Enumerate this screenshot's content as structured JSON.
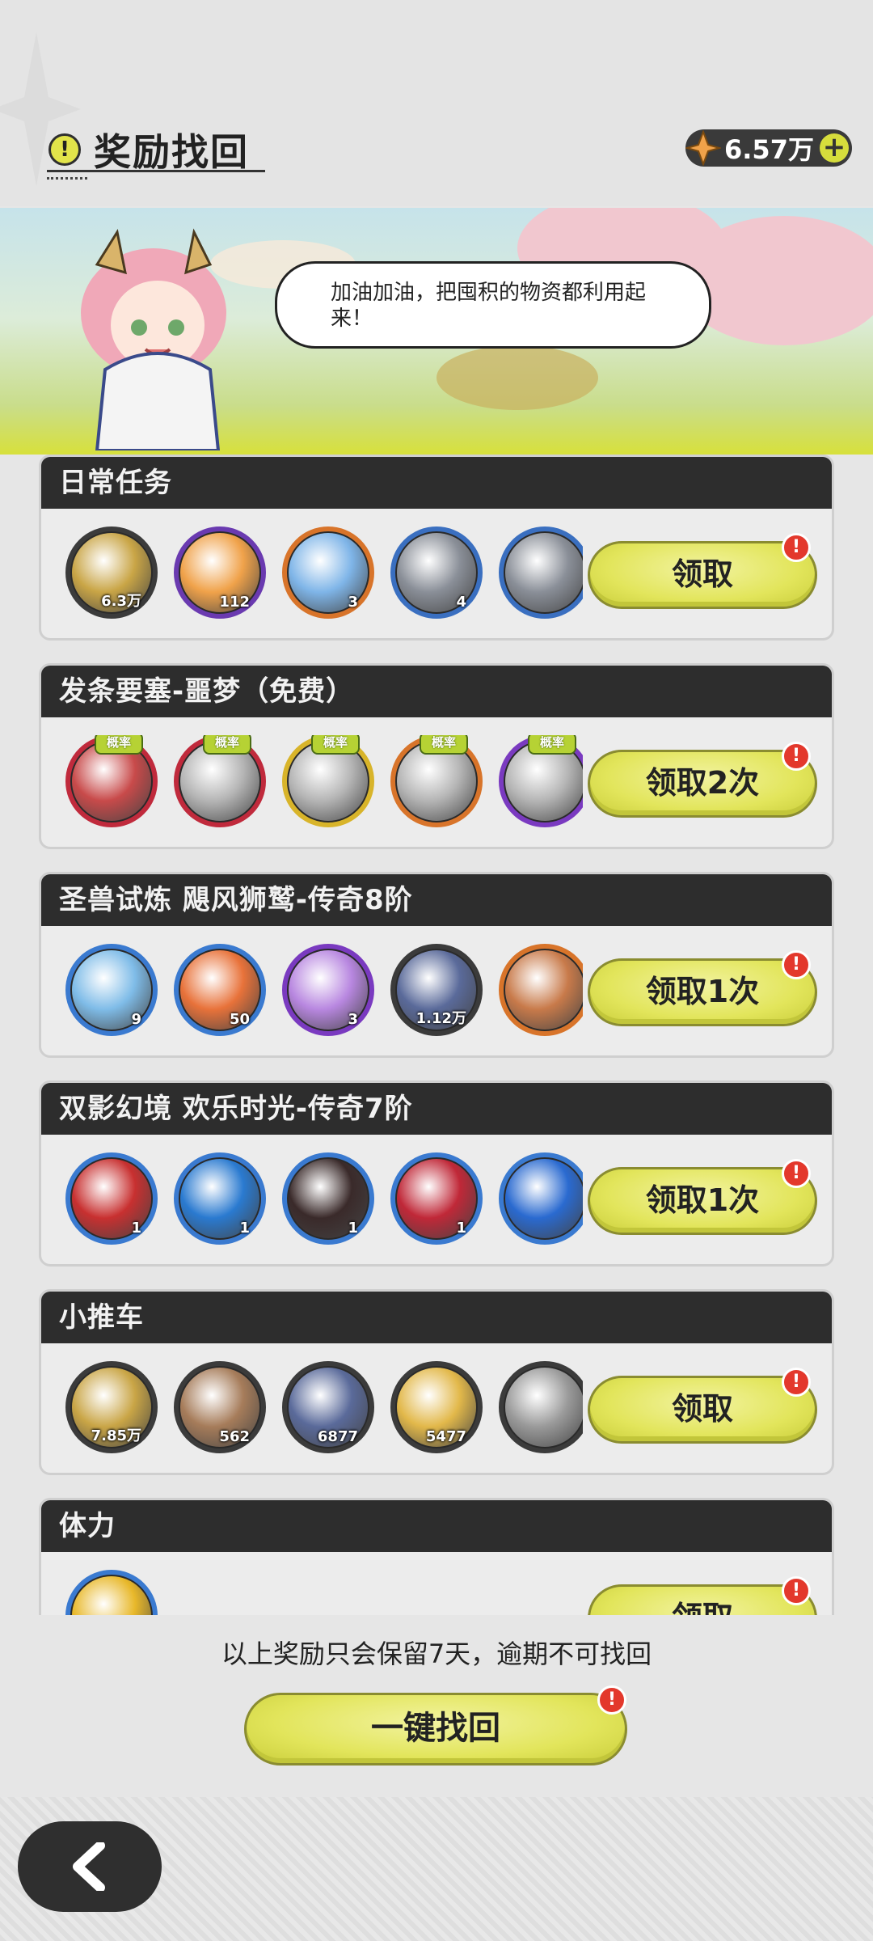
{
  "header": {
    "title": "奖励找回",
    "currency_value": "6.57万"
  },
  "banner": {
    "speech": "加油加油，把囤积的物资都利用起来！"
  },
  "cards": [
    {
      "title": "日常任务",
      "claim_label": "领取",
      "items": [
        {
          "icon": "gold-coin-icon",
          "qty": "6.3万",
          "ring": "#3b3b3b",
          "fill": "#c9a546"
        },
        {
          "icon": "orange-crystal-star-icon",
          "qty": "112",
          "ring": "#6a3ab0",
          "fill": "#f0a24a"
        },
        {
          "icon": "blue-snowflake-crystal-icon",
          "qty": "3",
          "ring": "#d8742a",
          "fill": "#7fb5e8"
        },
        {
          "icon": "hammer-icon",
          "qty": "4",
          "ring": "#3a6fc0",
          "fill": "#8a8f98"
        },
        {
          "icon": "pickaxe-icon",
          "qty": "",
          "ring": "#3a6fc0",
          "fill": "#8a8f98"
        }
      ]
    },
    {
      "title": "发条要塞-噩梦（免费）",
      "claim_label": "领取2次",
      "items": [
        {
          "icon": "mystery-armor-icon",
          "qty": "",
          "ring": "#c02a3c",
          "fill": "#c84a4a",
          "rate": "概率"
        },
        {
          "icon": "mystery-armor-icon",
          "qty": "",
          "ring": "#c02a3c",
          "fill": "#b5b5b5",
          "rate": "概率"
        },
        {
          "icon": "mystery-armor-icon",
          "qty": "",
          "ring": "#d8b42a",
          "fill": "#b5b5b5",
          "rate": "概率"
        },
        {
          "icon": "mystery-armor-icon",
          "qty": "",
          "ring": "#d8742a",
          "fill": "#b5b5b5",
          "rate": "概率"
        },
        {
          "icon": "mystery-armor-icon",
          "qty": "",
          "ring": "#7a3ac0",
          "fill": "#b5b5b5",
          "rate": "概率"
        }
      ]
    },
    {
      "title": "圣兽试炼 飓风狮鹫-传奇8阶",
      "claim_label": "领取1次",
      "items": [
        {
          "icon": "blue-gift-box-icon",
          "qty": "9",
          "ring": "#3a7ad0",
          "fill": "#7fbce8"
        },
        {
          "icon": "orange-crystal-cluster-icon",
          "qty": "50",
          "ring": "#3a7ad0",
          "fill": "#e8723a"
        },
        {
          "icon": "purple-gift-box-icon",
          "qty": "3",
          "ring": "#7a3ac0",
          "fill": "#b887e0"
        },
        {
          "icon": "blue-ore-icon",
          "qty": "1.12万",
          "ring": "#3b3b3b",
          "fill": "#5a6a9a"
        },
        {
          "icon": "orange-item-icon",
          "qty": "",
          "ring": "#d8742a",
          "fill": "#c87a4a"
        }
      ]
    },
    {
      "title": "双影幻境 欢乐时光-传奇7阶",
      "claim_label": "领取1次",
      "items": [
        {
          "icon": "red-gem-icon",
          "qty": "1",
          "ring": "#3a7ad0",
          "fill": "#c83030"
        },
        {
          "icon": "blue-gem-icon",
          "qty": "1",
          "ring": "#3a7ad0",
          "fill": "#2a7ad0"
        },
        {
          "icon": "black-gem-icon",
          "qty": "1",
          "ring": "#3a7ad0",
          "fill": "#3a2a2a"
        },
        {
          "icon": "crimson-gem-icon",
          "qty": "1",
          "ring": "#3a7ad0",
          "fill": "#c02838"
        },
        {
          "icon": "blue-gem-icon",
          "qty": "",
          "ring": "#3a7ad0",
          "fill": "#2a6ad0"
        }
      ]
    },
    {
      "title": "小推车",
      "claim_label": "领取",
      "items": [
        {
          "icon": "gold-coin-icon",
          "qty": "7.85万",
          "ring": "#3b3b3b",
          "fill": "#c9a546"
        },
        {
          "icon": "grain-sack-icon",
          "qty": "562",
          "ring": "#3b3b3b",
          "fill": "#a67c5a"
        },
        {
          "icon": "blue-ore-icon",
          "qty": "6877",
          "ring": "#3b3b3b",
          "fill": "#5a6a9a"
        },
        {
          "icon": "gold-sand-icon",
          "qty": "5477",
          "ring": "#3b3b3b",
          "fill": "#e2b84a"
        },
        {
          "icon": "stone-icon",
          "qty": "",
          "ring": "#3b3b3b",
          "fill": "#9a9a9a"
        }
      ]
    },
    {
      "title": "体力",
      "claim_label": "领取",
      "items": [
        {
          "icon": "lightning-stamina-icon",
          "qty": "",
          "ring": "#3a7ad0",
          "fill": "#e8b82a"
        }
      ]
    }
  ],
  "footer": {
    "note": "以上奖励只会保留7天，逾期不可找回",
    "one_key_label": "一键找回"
  },
  "badge_symbol": "!",
  "colors": {
    "claim_button": "#e2e55b",
    "header_bar": "#2d2d2d",
    "alert_badge": "#e3382c"
  }
}
